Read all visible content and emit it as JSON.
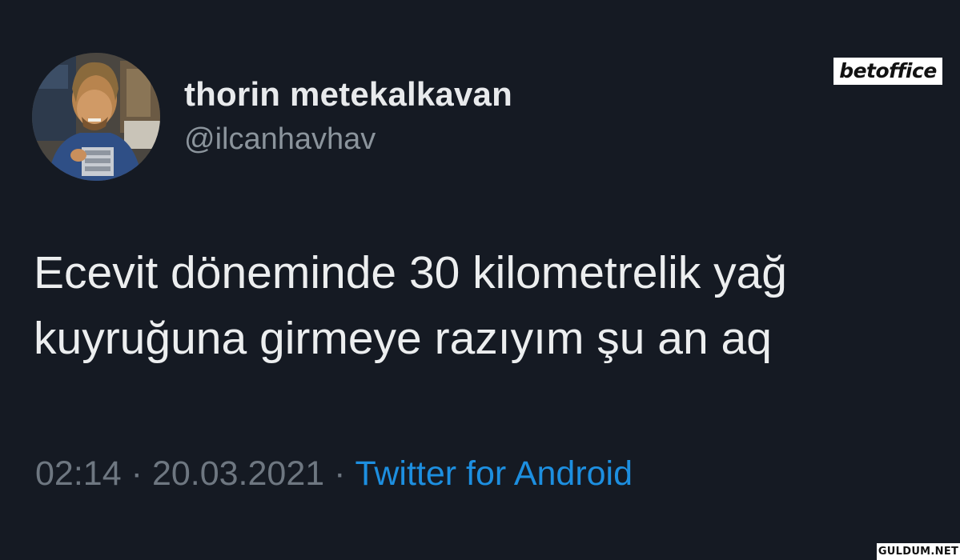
{
  "tweet": {
    "author": {
      "display_name": "thorin metekalkavan",
      "handle": "@ilcanhavhav"
    },
    "text_lines": [
      "Ecevit döneminde 30 kilometrelik yağ",
      "kuyruğuna girmeye razıyım şu an aq"
    ],
    "meta": {
      "time": "02:14",
      "separator": "·",
      "date": "20.03.2021",
      "source": "Twitter for Android"
    }
  },
  "overlays": {
    "watermark": "betoffice",
    "site": "GULDUM.NET"
  },
  "colors": {
    "background": "#151a23",
    "text": "#eceeef",
    "muted": "#6e7781",
    "link": "#1d8fe0"
  }
}
